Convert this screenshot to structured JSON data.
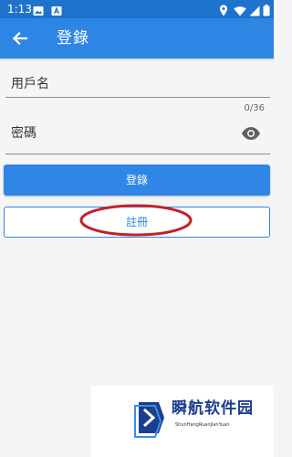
{
  "status_bar": {
    "time": "1:13",
    "left_icons": [
      "image-icon",
      "font-a-icon"
    ],
    "right_icons": [
      "location-icon",
      "wifi-icon",
      "signal-icon",
      "battery-icon"
    ]
  },
  "app_bar": {
    "title": "登錄",
    "back_icon": "arrow-back-icon"
  },
  "form": {
    "username": {
      "placeholder": "用戶名",
      "value": ""
    },
    "password": {
      "placeholder": "密碼",
      "value": "",
      "counter": "0/36",
      "toggle_icon": "eye-icon"
    },
    "login_button": "登錄",
    "register_button": "註冊"
  },
  "watermark": {
    "title": "瞬航软件园",
    "subtitle": "ShunHangRuanJianYuan"
  },
  "colors": {
    "app_bar": "#2e86e4",
    "status_bar": "#1f73cc",
    "button": "#2f86e6",
    "highlight": "#c2232a"
  }
}
